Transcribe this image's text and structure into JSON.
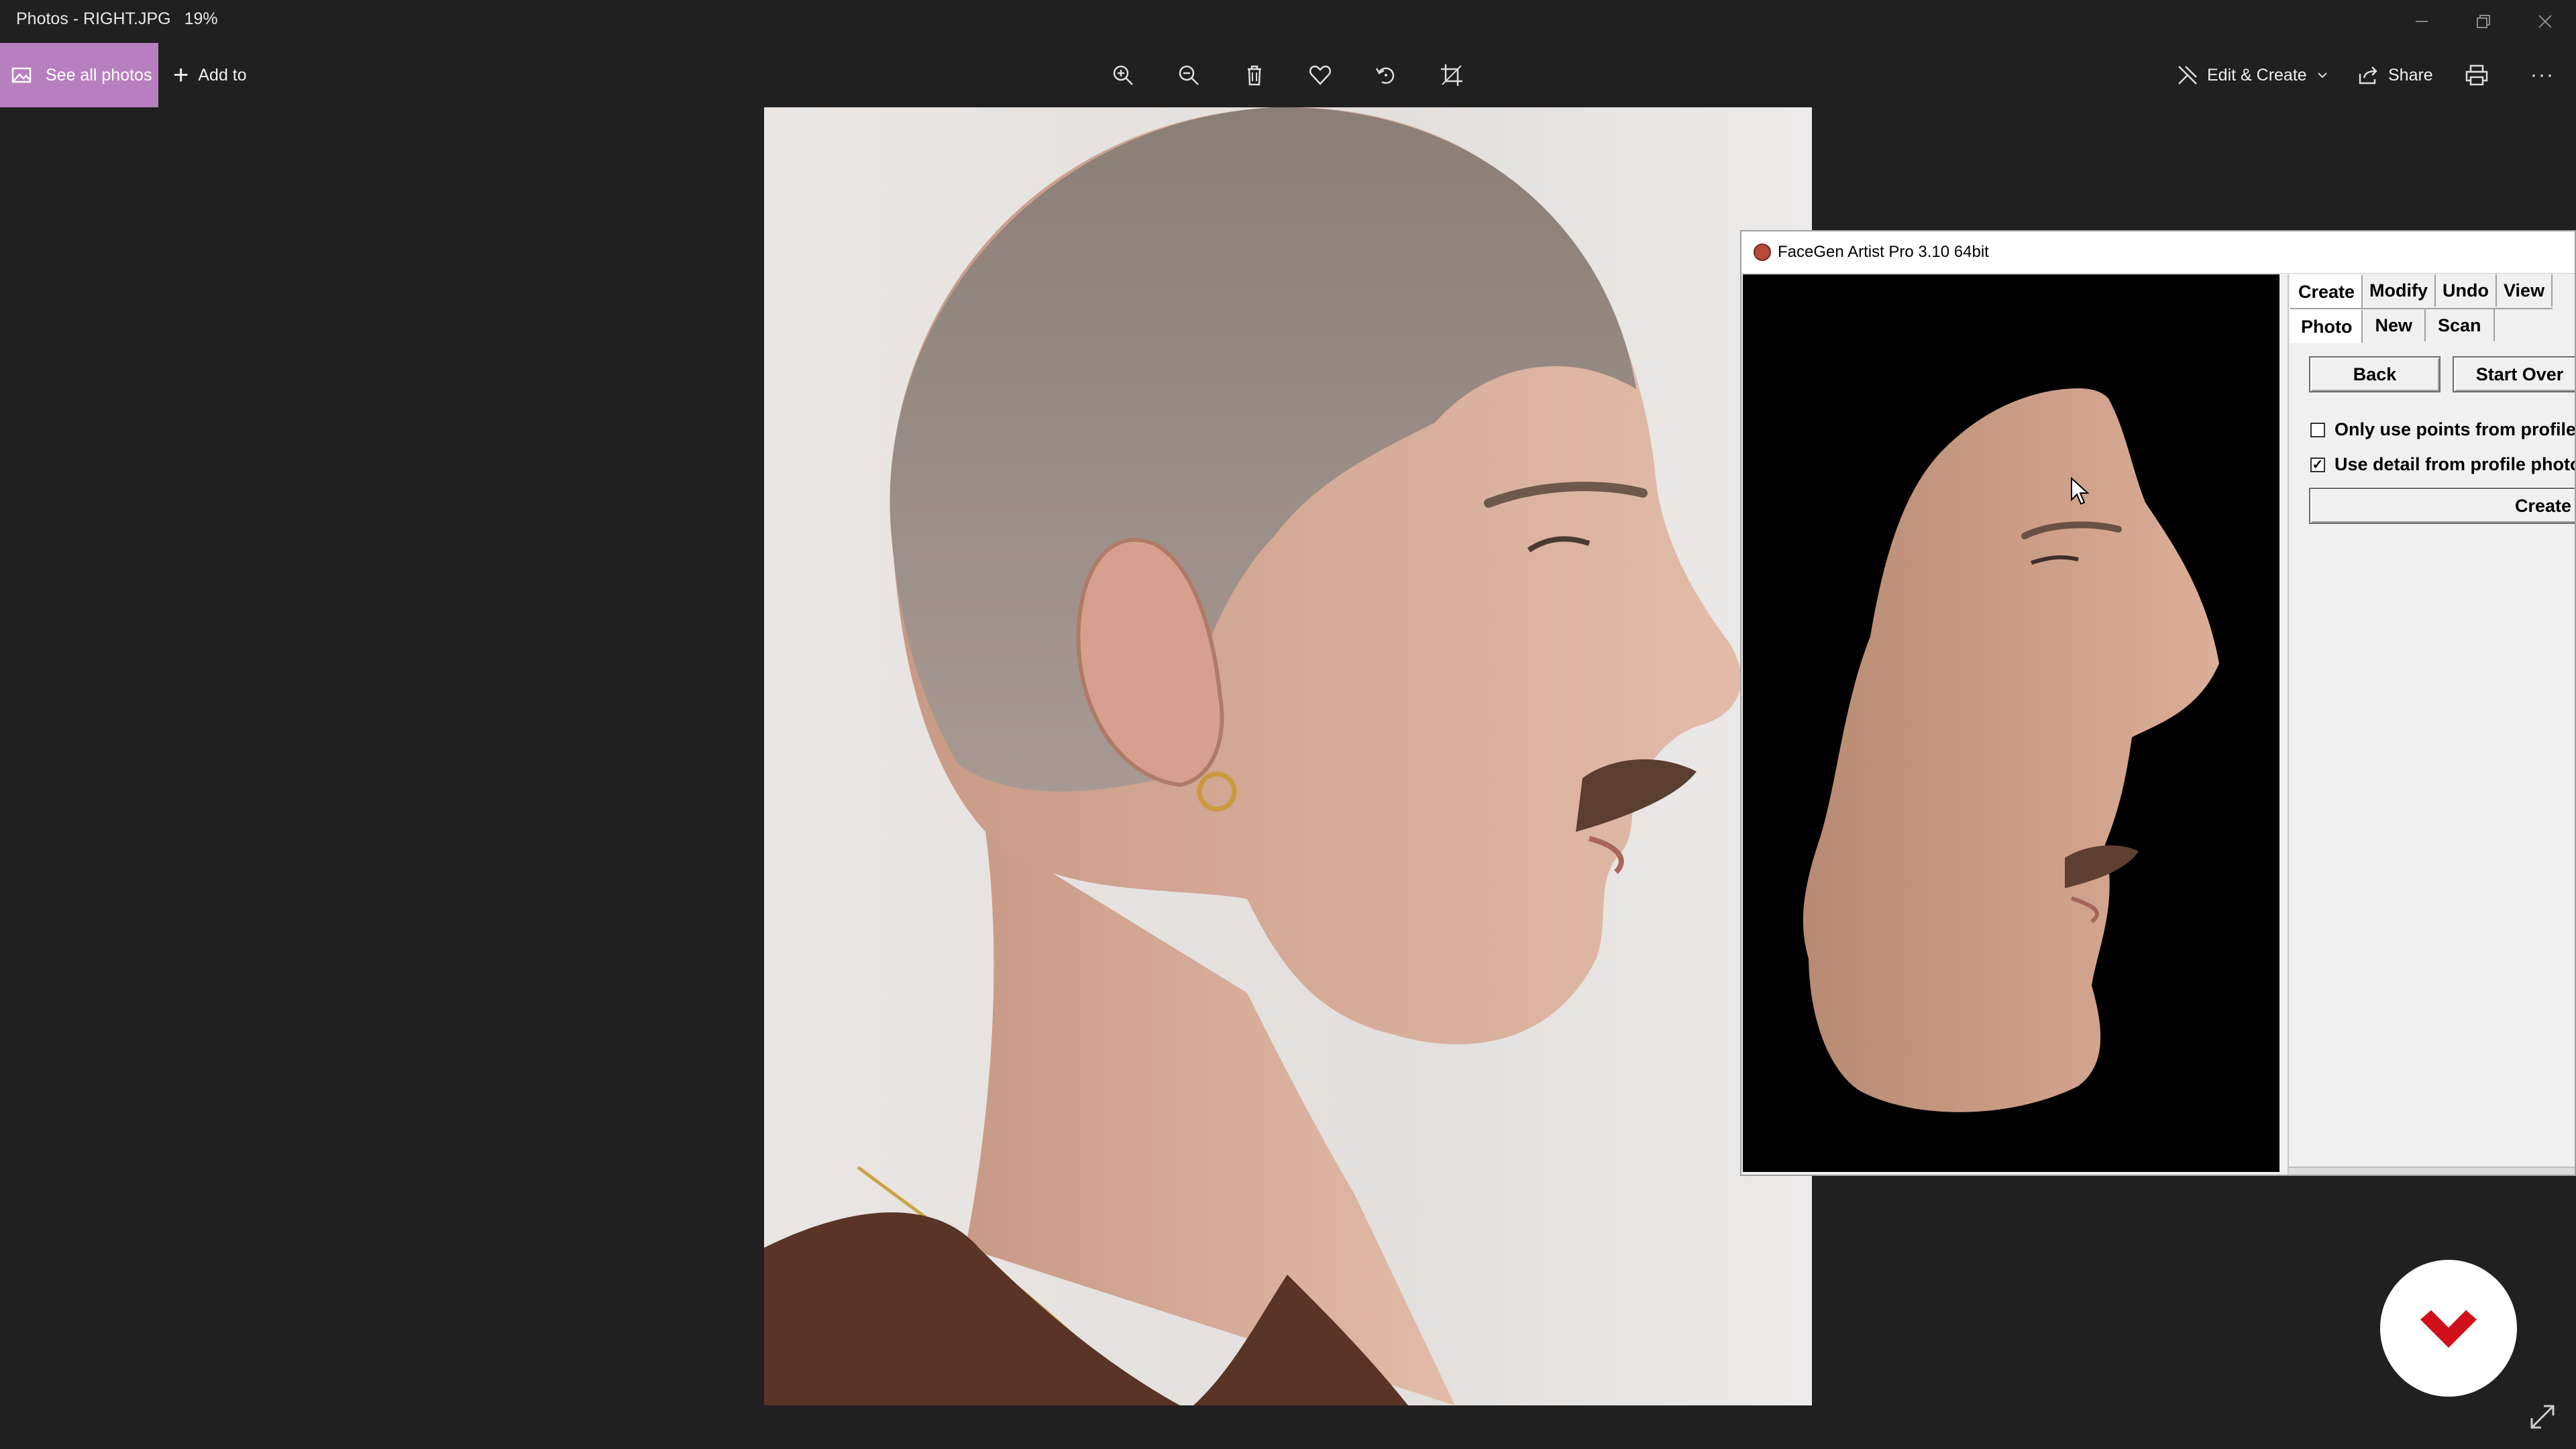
{
  "titlebar": {
    "title": "Photos - RIGHT.JPG",
    "zoom": "19%"
  },
  "toolbar": {
    "see_all_photos": "See all photos",
    "add_to": "Add to",
    "icons": [
      "zoom-in-icon",
      "zoom-out-icon",
      "delete-icon",
      "favorite-icon",
      "rotate-icon",
      "crop-icon"
    ],
    "edit_create": "Edit & Create",
    "share": "Share",
    "more": "···"
  },
  "facegen": {
    "title": "FaceGen Artist Pro 3.10 64bit",
    "tabs": [
      "Create",
      "Modify",
      "Undo",
      "View"
    ],
    "subtabs": [
      "Photo",
      "New",
      "Scan"
    ],
    "back": "Back",
    "start_over": "Start Over",
    "checkboxes": [
      {
        "label": "Only use points from profile",
        "checked": false
      },
      {
        "label": "Use detail from profile photo",
        "checked": true
      }
    ],
    "create_button": "Create fr"
  },
  "colors": {
    "accent": "#b87fc0",
    "background": "#202020",
    "logo_red": "#d0101a"
  }
}
